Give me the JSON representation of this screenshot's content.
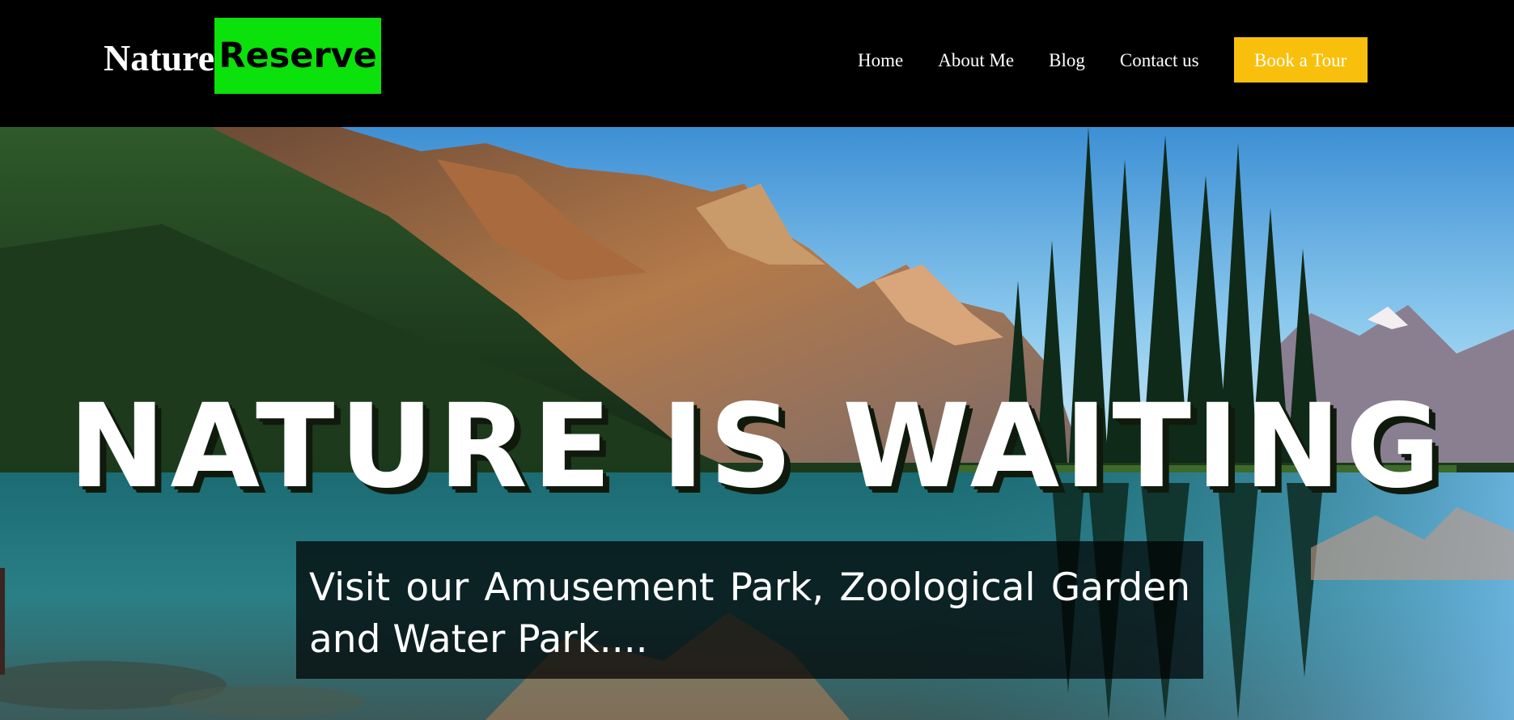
{
  "brand": {
    "word1": "Nature",
    "word2": "Reserve",
    "accent_color": "#0be10b"
  },
  "nav": {
    "items": [
      "Home",
      "About Me",
      "Blog",
      "Contact us"
    ],
    "cta_label": "Book a Tour",
    "cta_color": "#f8c00c"
  },
  "hero": {
    "headline": "NATURE IS WAITING",
    "tagline": "Visit our Amusement Park, Zoological Garden and Water Park....",
    "image": "mountain-lake-landscape"
  }
}
